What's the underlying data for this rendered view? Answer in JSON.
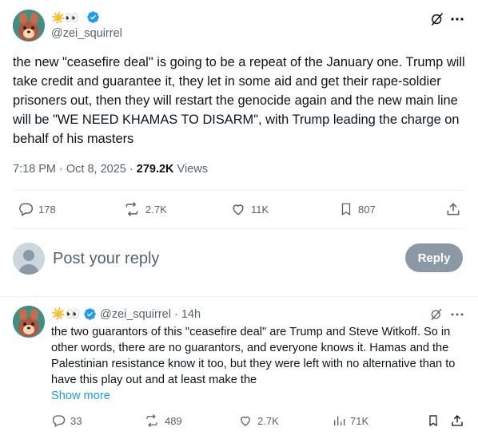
{
  "tweet": {
    "author_emoji": "☀️👀",
    "handle": "@zei_squirrel",
    "text": "the new \"ceasefire deal\" is going to be a repeat of the January one. Trump will take credit and guarantee it, they let in some aid and get their rape-soldier prisoners out, then they will restart the genocide again and the new main line will be \"WE NEED KHAMAS TO DISARM\", with Trump leading the charge on behalf of his masters",
    "time": "7:18 PM · Oct 8, 2025 · ",
    "views_count": "279.2K",
    "views_label": " Views",
    "replies": "178",
    "reposts": "2.7K",
    "likes": "11K",
    "bookmarks": "807"
  },
  "composer": {
    "placeholder": "Post your reply",
    "button_label": "Reply"
  },
  "reply": {
    "author_emoji": "☀️👀",
    "handle": "@zei_squirrel",
    "age": "· 14h",
    "text": "the two guarantors of this \"ceasefire deal\" are Trump and Steve Witkoff. So in other words, there are no guarantors, and everyone knows it. Hamas and the Palestinian resistance know it too, but they were left with no alternative than to have this play out and at least make the",
    "show_more": "Show more",
    "replies": "33",
    "reposts": "489",
    "likes": "2.7K",
    "views": "71K"
  },
  "colors": {
    "accent": "#1d9bf0",
    "muted": "#536471",
    "reply_button": "#8b98a5",
    "verified": "#1d9bf0"
  },
  "icons": [
    "grok-icon",
    "more-icon",
    "reply-icon",
    "repost-icon",
    "like-icon",
    "bookmark-icon",
    "share-icon",
    "views-icon",
    "verified-icon"
  ]
}
